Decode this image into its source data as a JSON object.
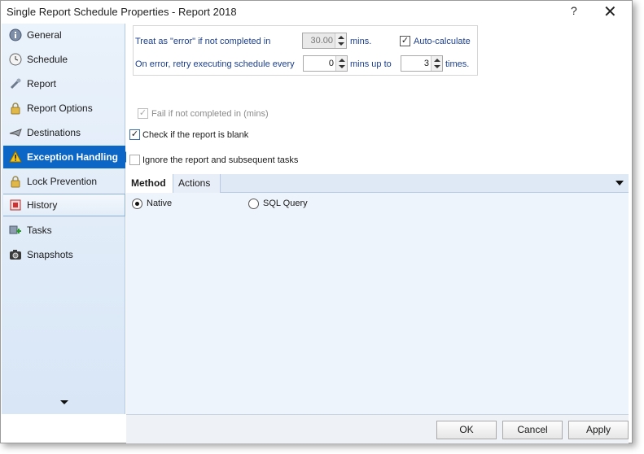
{
  "window": {
    "title": "Single Report Schedule Properties - Report 2018",
    "help_label": "?",
    "close_label": "✕"
  },
  "sidebar": {
    "items": [
      {
        "label": "General",
        "icon": "info-icon"
      },
      {
        "label": "Schedule",
        "icon": "clock-icon"
      },
      {
        "label": "Report",
        "icon": "wrench-icon"
      },
      {
        "label": "Report Options",
        "icon": "lock-icon"
      },
      {
        "label": "Destinations",
        "icon": "plane-icon"
      },
      {
        "label": "Exception Handling",
        "icon": "warning-icon",
        "active": true
      },
      {
        "label": "Lock Prevention",
        "icon": "lock-icon"
      },
      {
        "label": "History",
        "icon": "history-icon"
      },
      {
        "label": "Tasks",
        "icon": "tasks-icon"
      },
      {
        "label": "Snapshots",
        "icon": "camera-icon"
      }
    ]
  },
  "exception": {
    "treat_label": "Treat as \"error\" if not completed in",
    "treat_value": "30.00",
    "treat_unit": "mins.",
    "auto_calc_label": "Auto-calculate",
    "retry_label": "On error, retry  executing schedule every",
    "retry_value": "0",
    "retry_unit": "mins up to",
    "times_value": "3",
    "times_unit": "times.",
    "fail_label": "Fail if not completed in (mins)",
    "blank_label": "Check if the report is blank",
    "ignore_label": "Ignore the report and subsequent tasks"
  },
  "tabs": {
    "method": "Method",
    "actions": "Actions"
  },
  "method": {
    "native_label": "Native",
    "sql_label": "SQL Query"
  },
  "footer": {
    "ok": "OK",
    "cancel": "Cancel",
    "apply": "Apply"
  },
  "colors": {
    "accent": "#0b66c6",
    "label_blue": "#1d3f8a"
  }
}
